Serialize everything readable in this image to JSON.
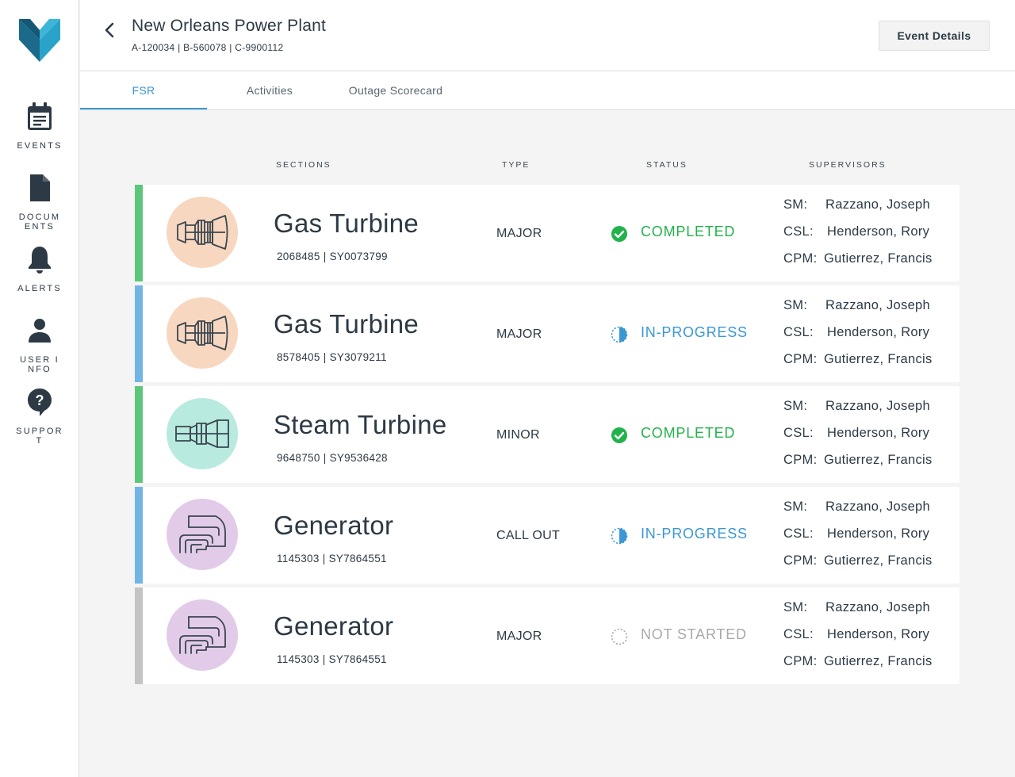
{
  "sidebar": {
    "items": [
      {
        "label": "EVENTS",
        "icon": "calendar-icon"
      },
      {
        "label": "DOCUMENTS",
        "icon": "document-icon"
      },
      {
        "label": "ALERTS",
        "icon": "bell-icon"
      },
      {
        "label": "USER INFO",
        "icon": "user-icon"
      },
      {
        "label": "SUPPORT",
        "icon": "help-icon"
      }
    ]
  },
  "header": {
    "title": "New Orleans Power Plant",
    "subtitle": "A-120034 | B-560078 | C-9900112",
    "event_details_label": "Event Details"
  },
  "tabs": [
    {
      "label": "FSR",
      "active": true
    },
    {
      "label": "Activities",
      "active": false
    },
    {
      "label": "Outage Scorecard",
      "active": false
    }
  ],
  "columns": {
    "sections": "SECTIONS",
    "type": "TYPE",
    "status": "STATUS",
    "supervisors": "SUPERVISORS"
  },
  "colors": {
    "completed": "#22b24c",
    "in_progress": "#3a97d4",
    "not_started": "#a9a9a9",
    "bar_completed": "#5cc77b",
    "bar_in_progress": "#72b5e4",
    "bar_not_started": "#c4c4c4",
    "gas_turbine_bg": "#f7d7bf",
    "steam_turbine_bg": "#b8eadf",
    "generator_bg": "#e2cbe8"
  },
  "rows": [
    {
      "section": "Gas Turbine",
      "ids": "2068485  |  SY0073799",
      "type": "MAJOR",
      "status": "COMPLETED",
      "status_kind": "completed",
      "icon": "gas-turbine-icon",
      "supervisors": [
        {
          "role": "SM:",
          "name": "Razzano, Joseph"
        },
        {
          "role": "CSL:",
          "name": "Henderson, Rory"
        },
        {
          "role": "CPM:",
          "name": "Gutierrez, Francis"
        }
      ]
    },
    {
      "section": "Gas Turbine",
      "ids": "8578405  |  SY3079211",
      "type": "MAJOR",
      "status": "IN-PROGRESS",
      "status_kind": "in_progress",
      "icon": "gas-turbine-icon",
      "supervisors": [
        {
          "role": "SM:",
          "name": "Razzano, Joseph"
        },
        {
          "role": "CSL:",
          "name": "Henderson, Rory"
        },
        {
          "role": "CPM:",
          "name": "Gutierrez, Francis"
        }
      ]
    },
    {
      "section": "Steam Turbine",
      "ids": "9648750  |  SY9536428",
      "type": "MINOR",
      "status": "COMPLETED",
      "status_kind": "completed",
      "icon": "steam-turbine-icon",
      "supervisors": [
        {
          "role": "SM:",
          "name": "Razzano, Joseph"
        },
        {
          "role": "CSL:",
          "name": "Henderson, Rory"
        },
        {
          "role": "CPM:",
          "name": "Gutierrez, Francis"
        }
      ]
    },
    {
      "section": "Generator",
      "ids": "1145303  |  SY7864551",
      "type": "CALL OUT",
      "status": "IN-PROGRESS",
      "status_kind": "in_progress",
      "icon": "generator-icon",
      "supervisors": [
        {
          "role": "SM:",
          "name": "Razzano, Joseph"
        },
        {
          "role": "CSL:",
          "name": "Henderson, Rory"
        },
        {
          "role": "CPM:",
          "name": "Gutierrez, Francis"
        }
      ]
    },
    {
      "section": "Generator",
      "ids": "1145303  |  SY7864551",
      "type": "MAJOR",
      "status": "NOT STARTED",
      "status_kind": "not_started",
      "icon": "generator-icon",
      "supervisors": [
        {
          "role": "SM:",
          "name": "Razzano, Joseph"
        },
        {
          "role": "CSL:",
          "name": "Henderson, Rory"
        },
        {
          "role": "CPM:",
          "name": "Gutierrez, Francis"
        }
      ]
    }
  ]
}
